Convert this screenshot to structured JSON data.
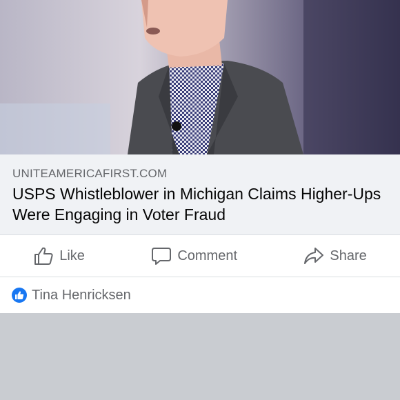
{
  "post": {
    "image_alt": "Man in grey suit and checked shirt speaking",
    "link": {
      "domain": "UNITEAMERICAFIRST.COM",
      "headline": "USPS Whistleblower in Michigan Claims Higher-Ups Were Engaging in Voter Fraud"
    },
    "actions": {
      "like_label": "Like",
      "comment_label": "Comment",
      "share_label": "Share"
    },
    "reactions": {
      "reactor_name": "Tina Henricksen",
      "icon": "like-reaction-icon"
    }
  },
  "colors": {
    "brand_blue": "#1877f2",
    "secondary_text": "#65676b",
    "card_bg": "#f0f2f5",
    "feed_bg": "#c9ccd1"
  }
}
